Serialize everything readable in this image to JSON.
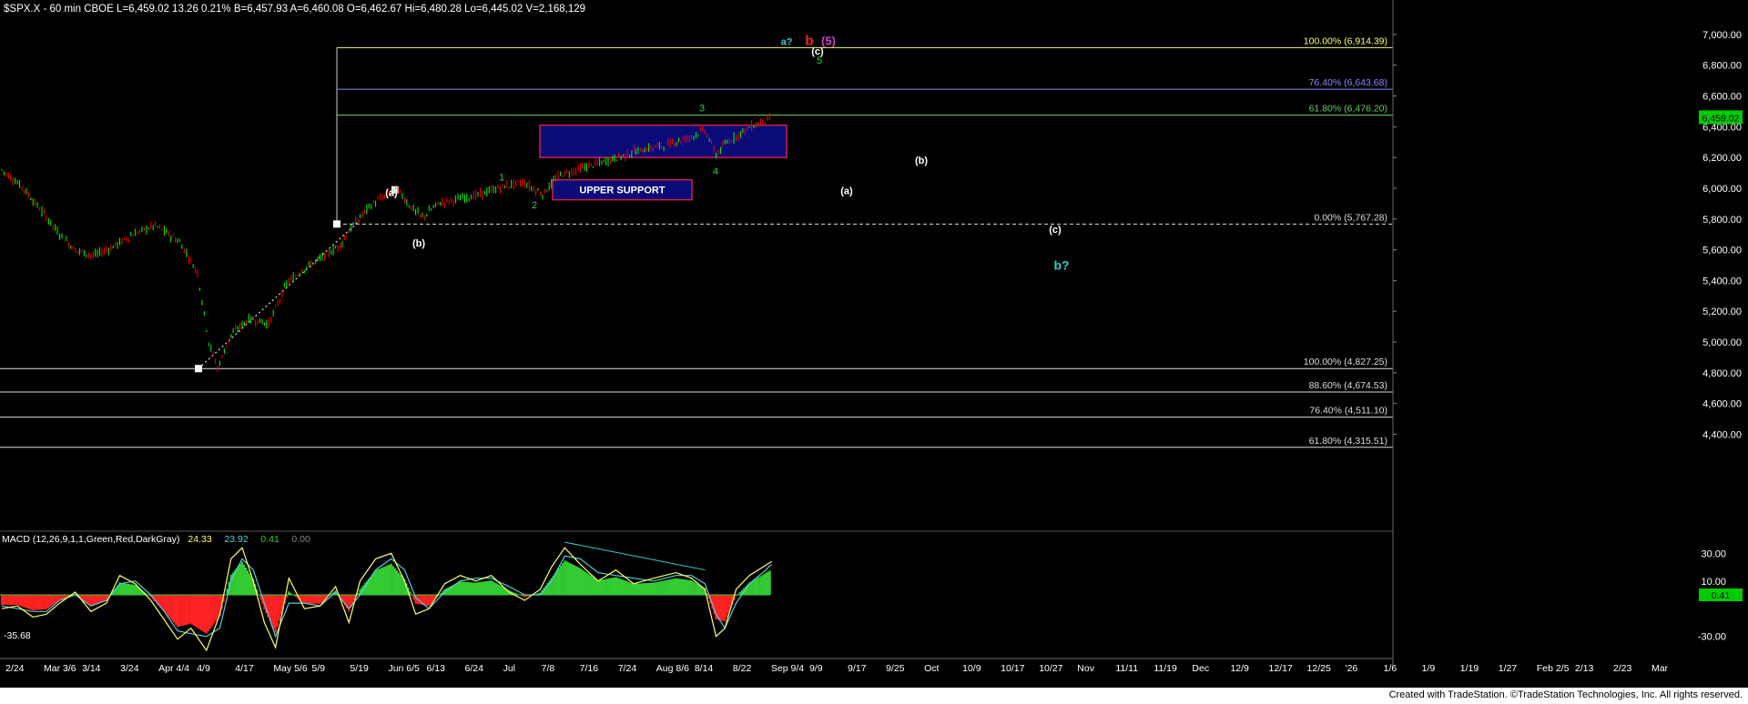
{
  "header": {
    "symbol_line": "$SPX.X - 60 min  CBOE   L=6,459.02   13.26   0.21%   B=6,457.93   A=6,460.08   O=6,462.67   Hi=6,480.28   Lo=6,445.02   V=2,168,129"
  },
  "footer": "Created with TradeStation. ©TradeStation Technologies, Inc. All rights reserved.",
  "colors": {
    "background": "#000000",
    "up_bar": "#00ff00",
    "down_bar": "#ff0000",
    "box_fill": "#0a0a78",
    "box_border": "#cc2244",
    "macd_line": "#ffff66",
    "signal_line": "#55ccdd"
  },
  "chart_data": [
    {
      "type": "line",
      "name": "price",
      "ylim": [
        3900,
        7100
      ],
      "y_ticks": [
        "7,000.00",
        "6,800.00",
        "6,600.00",
        "6,400.00",
        "6,200.00",
        "6,000.00",
        "5,800.00",
        "5,600.00",
        "5,400.00",
        "5,200.00",
        "5,000.00",
        "4,800.00",
        "4,600.00",
        "4,400.00"
      ],
      "x_ticks": [
        "2/24",
        "Mar 3/6",
        "3/14",
        "3/24",
        "Apr 4/4",
        "4/9",
        "4/17",
        "May 5/6",
        "5/9",
        "5/19",
        "Jun 6/5",
        "6/13",
        "6/24",
        "Jul",
        "7/8",
        "7/16",
        "7/24",
        "Aug 8/6",
        "8/14",
        "8/22",
        "Sep 9/4",
        "9/9",
        "9/17",
        "9/25",
        "Oct",
        "10/9",
        "10/17",
        "10/27",
        "Nov",
        "11/11",
        "11/19",
        "Dec",
        "12/9",
        "12/17",
        "12/25",
        "'26",
        "1/6",
        "1/9",
        "1/19",
        "1/27",
        "Feb 2/5",
        "2/13",
        "2/23",
        "Mar"
      ],
      "last_price": "6,459.02",
      "fib_levels": [
        {
          "label": "100.00% (6,914.39)",
          "value": 6914.39,
          "color": "#ffff66"
        },
        {
          "label": "76.40% (6,643.68)",
          "value": 6643.68,
          "color": "#8888ff"
        },
        {
          "label": "61.80% (6,476.20)",
          "value": 6476.2,
          "color": "#66cc66"
        },
        {
          "label": "0.00% (5,767.28)",
          "value": 5767.28,
          "color": "#dddddd"
        },
        {
          "label": "100.00% (4,827.25)",
          "value": 4827.25,
          "color": "#dddddd"
        },
        {
          "label": "88.60% (4,674.53)",
          "value": 4674.53,
          "color": "#dddddd"
        },
        {
          "label": "76.40% (4,511.10)",
          "value": 4511.1,
          "color": "#dddddd"
        },
        {
          "label": "61.80% (4,315.51)",
          "value": 4315.51,
          "color": "#dddddd"
        }
      ],
      "zones": [
        {
          "label": "",
          "y_top": 6410,
          "y_bottom": 6200
        },
        {
          "label": "UPPER SUPPORT",
          "y_top": 6055,
          "y_bottom": 5925
        }
      ],
      "wave_labels": [
        {
          "text": "a?",
          "color": "#33ccdd",
          "price": 6930
        },
        {
          "text": "b",
          "color": "#ff2222",
          "price": 6930
        },
        {
          "text": "(5)",
          "color": "#cc44cc",
          "price": 6930
        },
        {
          "text": "(c)",
          "color": "#ffffff",
          "price": 6870
        },
        {
          "text": "5",
          "color": "#33cc33",
          "price": 6810
        },
        {
          "text": "3",
          "color": "#33cc33",
          "price": 6500
        },
        {
          "text": "4",
          "color": "#33cc33",
          "price": 6090
        },
        {
          "text": "1",
          "color": "#33cc33",
          "price": 6050
        },
        {
          "text": "2",
          "color": "#33cc33",
          "price": 5870
        },
        {
          "text": "(a)",
          "color": "#ffffff",
          "price": 5950
        },
        {
          "text": "(b)",
          "color": "#ffffff",
          "price": 5620
        },
        {
          "text": "(a)",
          "color": "#ffffff",
          "price": 5960
        },
        {
          "text": "(b)",
          "color": "#ffffff",
          "price": 6160
        },
        {
          "text": "(c)",
          "color": "#ffffff",
          "price": 5710
        },
        {
          "text": "b?",
          "color": "#33cccc",
          "price": 5470
        }
      ],
      "path": [
        [
          0,
          6120
        ],
        [
          18,
          6010
        ],
        [
          36,
          5850
        ],
        [
          52,
          5700
        ],
        [
          66,
          5600
        ],
        [
          82,
          5560
        ],
        [
          100,
          5620
        ],
        [
          118,
          5700
        ],
        [
          138,
          5760
        ],
        [
          160,
          5650
        ],
        [
          176,
          5450
        ],
        [
          186,
          5000
        ],
        [
          194,
          4830
        ],
        [
          206,
          5050
        ],
        [
          222,
          5150
        ],
        [
          240,
          5120
        ],
        [
          256,
          5380
        ],
        [
          272,
          5480
        ],
        [
          288,
          5550
        ],
        [
          304,
          5630
        ],
        [
          316,
          5760
        ],
        [
          330,
          5880
        ],
        [
          344,
          5950
        ],
        [
          356,
          5990
        ],
        [
          366,
          5890
        ],
        [
          378,
          5810
        ],
        [
          392,
          5900
        ],
        [
          410,
          5930
        ],
        [
          430,
          5960
        ],
        [
          450,
          6010
        ],
        [
          468,
          6040
        ],
        [
          486,
          5960
        ],
        [
          500,
          6080
        ],
        [
          520,
          6130
        ],
        [
          545,
          6180
        ],
        [
          570,
          6240
        ],
        [
          595,
          6280
        ],
        [
          618,
          6330
        ],
        [
          632,
          6380
        ],
        [
          642,
          6220
        ],
        [
          652,
          6300
        ],
        [
          668,
          6380
        ],
        [
          682,
          6430
        ],
        [
          692,
          6459
        ]
      ]
    },
    {
      "type": "area",
      "name": "MACD",
      "legend": [
        "MACD (12,26,9,1,1,Green,Red,DarkGray)",
        "24.33",
        "23.92",
        "0.41",
        "0.00"
      ],
      "legend_colors": [
        "#ffffff",
        "#ffff66",
        "#55ccdd",
        "#33cc33",
        "#888888"
      ],
      "ylim": [
        -42,
        42
      ],
      "y_ticks": [
        "30.00",
        "10.00",
        "-30.00"
      ],
      "last_value": "0.41",
      "left_value": "-35.68",
      "macd_line": [
        [
          0,
          -10
        ],
        [
          14,
          -8
        ],
        [
          28,
          -16
        ],
        [
          40,
          -14
        ],
        [
          52,
          -6
        ],
        [
          66,
          2
        ],
        [
          80,
          -12
        ],
        [
          94,
          -6
        ],
        [
          106,
          14
        ],
        [
          120,
          8
        ],
        [
          134,
          -4
        ],
        [
          146,
          -18
        ],
        [
          158,
          -32
        ],
        [
          170,
          -24
        ],
        [
          184,
          -40
        ],
        [
          196,
          -14
        ],
        [
          206,
          26
        ],
        [
          216,
          34
        ],
        [
          226,
          10
        ],
        [
          236,
          -20
        ],
        [
          246,
          -38
        ],
        [
          258,
          12
        ],
        [
          272,
          -10
        ],
        [
          286,
          -8
        ],
        [
          300,
          6
        ],
        [
          312,
          -20
        ],
        [
          322,
          10
        ],
        [
          336,
          26
        ],
        [
          350,
          30
        ],
        [
          362,
          10
        ],
        [
          372,
          -14
        ],
        [
          384,
          -10
        ],
        [
          398,
          8
        ],
        [
          412,
          14
        ],
        [
          426,
          10
        ],
        [
          440,
          14
        ],
        [
          456,
          2
        ],
        [
          470,
          -4
        ],
        [
          484,
          4
        ],
        [
          494,
          20
        ],
        [
          506,
          34
        ],
        [
          520,
          22
        ],
        [
          536,
          10
        ],
        [
          552,
          18
        ],
        [
          568,
          8
        ],
        [
          586,
          12
        ],
        [
          606,
          16
        ],
        [
          620,
          12
        ],
        [
          632,
          4
        ],
        [
          642,
          -30
        ],
        [
          650,
          -24
        ],
        [
          660,
          4
        ],
        [
          672,
          14
        ],
        [
          684,
          20
        ],
        [
          692,
          24
        ]
      ],
      "signal_line": [
        [
          0,
          -8
        ],
        [
          14,
          -10
        ],
        [
          28,
          -12
        ],
        [
          40,
          -12
        ],
        [
          52,
          -4
        ],
        [
          66,
          0
        ],
        [
          80,
          -8
        ],
        [
          94,
          -4
        ],
        [
          106,
          8
        ],
        [
          120,
          10
        ],
        [
          134,
          0
        ],
        [
          146,
          -12
        ],
        [
          158,
          -26
        ],
        [
          170,
          -28
        ],
        [
          184,
          -30
        ],
        [
          196,
          -24
        ],
        [
          206,
          10
        ],
        [
          216,
          26
        ],
        [
          226,
          18
        ],
        [
          236,
          -6
        ],
        [
          246,
          -30
        ],
        [
          258,
          -6
        ],
        [
          272,
          -6
        ],
        [
          286,
          -8
        ],
        [
          300,
          2
        ],
        [
          312,
          -10
        ],
        [
          322,
          0
        ],
        [
          336,
          18
        ],
        [
          350,
          26
        ],
        [
          362,
          18
        ],
        [
          372,
          -2
        ],
        [
          384,
          -10
        ],
        [
          398,
          2
        ],
        [
          412,
          10
        ],
        [
          426,
          12
        ],
        [
          440,
          12
        ],
        [
          456,
          6
        ],
        [
          470,
          0
        ],
        [
          484,
          0
        ],
        [
          494,
          10
        ],
        [
          506,
          28
        ],
        [
          520,
          26
        ],
        [
          536,
          16
        ],
        [
          552,
          14
        ],
        [
          568,
          12
        ],
        [
          586,
          10
        ],
        [
          606,
          14
        ],
        [
          620,
          14
        ],
        [
          632,
          8
        ],
        [
          642,
          -14
        ],
        [
          650,
          -24
        ],
        [
          660,
          -6
        ],
        [
          672,
          8
        ],
        [
          684,
          16
        ],
        [
          692,
          22
        ]
      ]
    }
  ]
}
